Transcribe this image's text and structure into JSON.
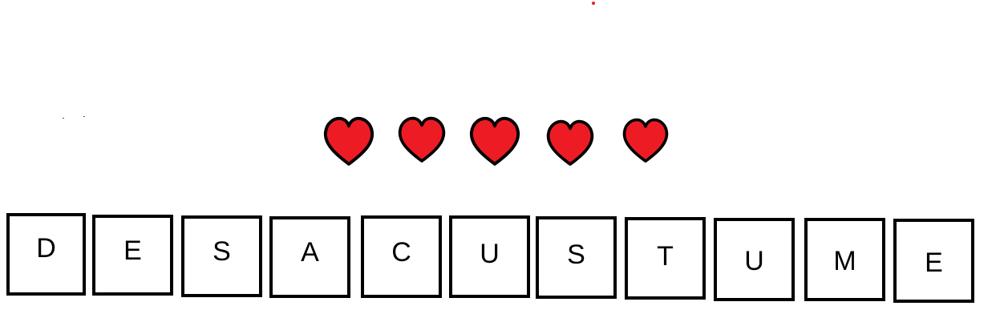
{
  "lives": {
    "count": 5,
    "heart_icon": "heart-icon",
    "fill_color": "#ed1c24",
    "outline_color": "#000000"
  },
  "word": {
    "letters": [
      "D",
      "E",
      "S",
      "A",
      "C",
      "U",
      "S",
      "T",
      "U",
      "M",
      "E"
    ]
  },
  "colors": {
    "background": "#ffffff",
    "tile_border": "#000000",
    "marker_dot": "#ed1c24"
  }
}
